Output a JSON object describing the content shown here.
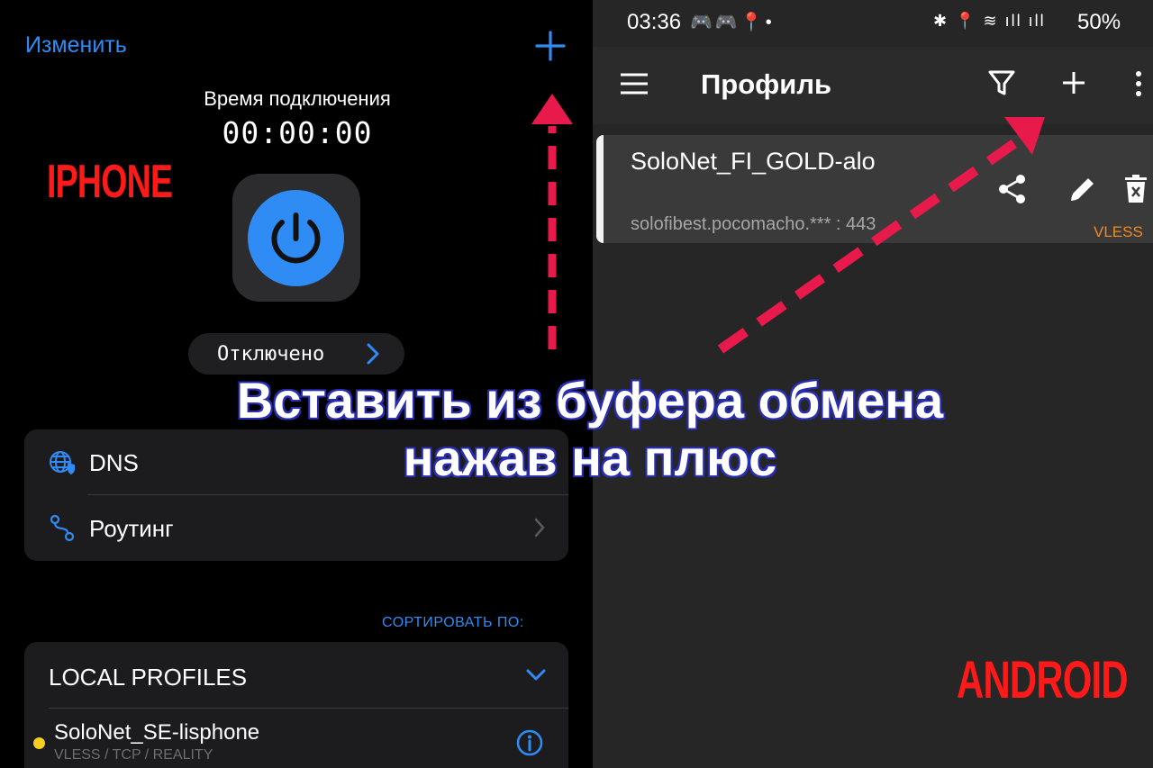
{
  "iphone": {
    "label": "IPHONE",
    "edit_label": "Изменить",
    "connection_title": "Время подключения",
    "connection_time": "00:00:00",
    "status": "Отключено",
    "settings": [
      {
        "label": "DNS"
      },
      {
        "label": "Роутинг"
      }
    ],
    "sort_label": "СОРТИРОВАТЬ ПО:",
    "profiles_title": "LOCAL PROFILES",
    "profile": {
      "name": "SoloNet_SE-lisphone",
      "meta": "VLESS / TCP / REALITY"
    },
    "accent_color": "#2f8cf4"
  },
  "android": {
    "label": "ANDROID",
    "statusbar": {
      "time": "03:36",
      "battery": "50%"
    },
    "title": "Профиль",
    "server": {
      "name": "SoloNet_FI_GOLD-alo",
      "address": "solofibest.pocomacho.*** : 443",
      "protocol": "VLESS"
    },
    "protocol_color": "#f28a20"
  },
  "caption": {
    "line1": "Вставить из буфера обмена",
    "line2": "нажав на плюс"
  },
  "arrow_color": "#e8194b"
}
